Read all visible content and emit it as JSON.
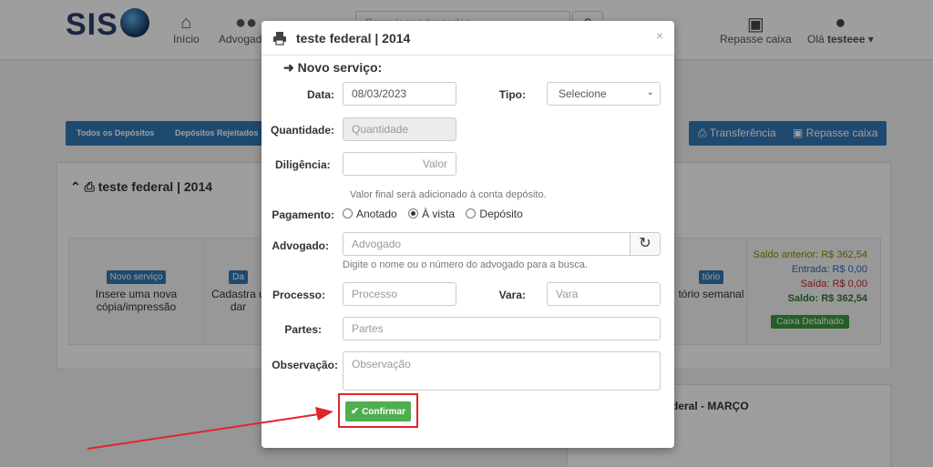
{
  "app": {
    "logo": "SIS",
    "nav": [
      {
        "label": "Início",
        "icon": "home-icon"
      },
      {
        "label": "Advogados",
        "icon": "users-icon"
      }
    ],
    "search_placeholder": "Pesquisar advogados",
    "right_nav": [
      {
        "label": "Repasse caixa",
        "icon": "money-icon"
      },
      {
        "label": "Olá ",
        "user": "testeee",
        "icon": "user-icon"
      }
    ],
    "tabs": [
      "Todos os Depósitos",
      "Depósitos Rejeitados"
    ],
    "actions": [
      "Transferência",
      "Repasse caixa"
    ],
    "panel_title": "teste federal | 2014",
    "cards": [
      {
        "label": "Novo serviço",
        "text": "Insere uma nova cópia/impressão"
      },
      {
        "label": "Da",
        "text": "Cadastra u dar"
      },
      {
        "label": "tório",
        "text": "tório semanal"
      }
    ],
    "caixa": {
      "anterior": "Saldo anterior: R$ 362,54",
      "entrada": "Entrada: R$ 0,00",
      "saida": "Saída: R$ 0,00",
      "saldo": "Saldo: R$ 362,54",
      "button": "Caixa Detalhado"
    },
    "panel2_title": "deral - MARÇO"
  },
  "modal": {
    "title": "teste federal | 2014",
    "section": "Novo serviço:",
    "close": "×",
    "fields": {
      "data_label": "Data:",
      "data_value": "08/03/2023",
      "tipo_label": "Tipo:",
      "tipo_value": "Selecione",
      "quantidade_label": "Quantidade:",
      "quantidade_placeholder": "Quantidade",
      "diligencia_label": "Diligência:",
      "diligencia_placeholder": "Valor",
      "diligencia_help": "Valor final será adicionado à conta depósito.",
      "pagamento_label": "Pagamento:",
      "pagamento_options": [
        "Anotado",
        "À vista",
        "Depósito"
      ],
      "pagamento_selected": 1,
      "advogado_label": "Advogado:",
      "advogado_placeholder": "Advogado",
      "advogado_help": "Digite o nome ou o número do advogado para a busca.",
      "processo_label": "Processo:",
      "processo_placeholder": "Processo",
      "vara_label": "Vara:",
      "vara_placeholder": "Vara",
      "partes_label": "Partes:",
      "partes_placeholder": "Partes",
      "observacao_label": "Observação:",
      "observacao_placeholder": "Observação"
    },
    "confirm_label": "Confirmar"
  },
  "colors": {
    "primary": "#3278b5",
    "success": "#4fae4f",
    "highlight": "#e0252b"
  }
}
